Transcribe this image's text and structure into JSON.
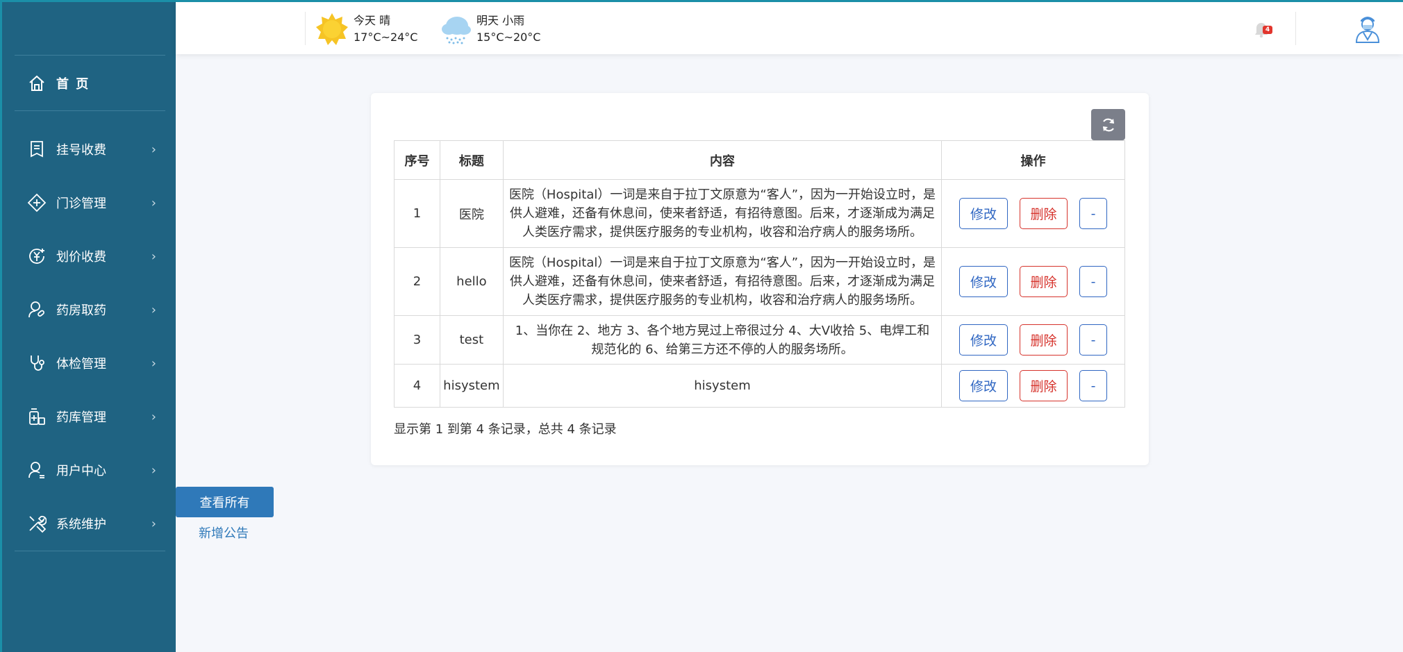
{
  "sidebar": {
    "home_label": "首 页",
    "items": [
      {
        "label": "挂号收费",
        "icon": "register-fee-icon"
      },
      {
        "label": "门诊管理",
        "icon": "clinic-icon"
      },
      {
        "label": "划价收费",
        "icon": "yen-coin-icon"
      },
      {
        "label": "药房取药",
        "icon": "pharmacy-user-icon"
      },
      {
        "label": "体检管理",
        "icon": "stethoscope-icon"
      },
      {
        "label": "药库管理",
        "icon": "medicine-store-icon"
      },
      {
        "label": "用户中心",
        "icon": "user-icon"
      },
      {
        "label": "系统维护",
        "icon": "tools-icon"
      }
    ],
    "chevron": "›"
  },
  "header": {
    "today": {
      "label": "今天  晴",
      "temp": "17°C~24°C",
      "icon": "sun-icon"
    },
    "tomorrow": {
      "label": "明天  小雨",
      "temp": "15°C~20°C",
      "icon": "rain-cloud-icon"
    },
    "notification_count": "4"
  },
  "subnav": {
    "view_all": "查看所有",
    "add_notice": "新增公告"
  },
  "table": {
    "headers": [
      "序号",
      "标题",
      "内容",
      "操作"
    ],
    "rows": [
      {
        "no": "1",
        "title": "医院",
        "content": "医院（Hospital）一词是来自于拉丁文原意为“客人”，因为一开始设立时，是供人避难，还备有休息间，使来者舒适，有招待意图。后来，才逐渐成为满足人类医疗需求，提供医疗服务的专业机构，收容和治疗病人的服务场所。"
      },
      {
        "no": "2",
        "title": "hello",
        "content": "医院（Hospital）一词是来自于拉丁文原意为“客人”，因为一开始设立时，是供人避难，还备有休息间，使来者舒适，有招待意图。后来，才逐渐成为满足人类医疗需求，提供医疗服务的专业机构，收容和治疗病人的服务场所。"
      },
      {
        "no": "3",
        "title": "test",
        "content": "1、当你在 2、地方 3、各个地方晃过上帝很过分 4、大V收拾 5、电焊工和规范化的 6、给第三方还不停的人的服务场所。"
      },
      {
        "no": "4",
        "title": "hisystem",
        "content": "hisystem"
      }
    ],
    "edit_label": "修改",
    "delete_label": "删除",
    "minus_label": "-"
  },
  "pagination_info": "显示第 1 到第 4 条记录，总共 4 条记录",
  "colors": {
    "sidebar_bg": "#1f6382",
    "primary": "#2f79b9",
    "danger": "#d6322b"
  }
}
